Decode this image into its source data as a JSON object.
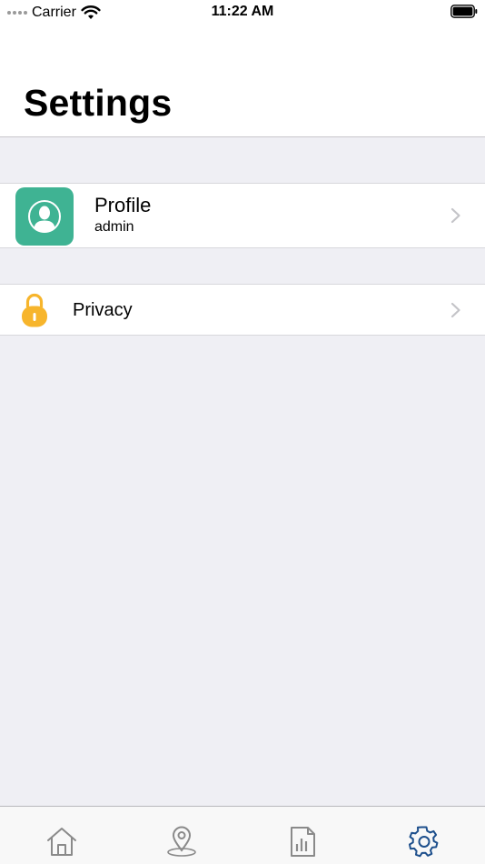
{
  "status_bar": {
    "carrier": "Carrier",
    "time": "11:22 AM"
  },
  "header": {
    "title": "Settings"
  },
  "profile_cell": {
    "title": "Profile",
    "subtitle": "admin",
    "tile_color": "#3fb393"
  },
  "privacy_cell": {
    "label": "Privacy",
    "icon_color": "#f7b52c"
  },
  "tab_bar": {
    "tabs": [
      {
        "icon": "home-icon",
        "selected": false
      },
      {
        "icon": "map-pin-icon",
        "selected": false
      },
      {
        "icon": "report-icon",
        "selected": false
      },
      {
        "icon": "gear-icon",
        "selected": true
      }
    ],
    "active_color": "#1d4f8c",
    "inactive_color": "#8a8a8a"
  }
}
